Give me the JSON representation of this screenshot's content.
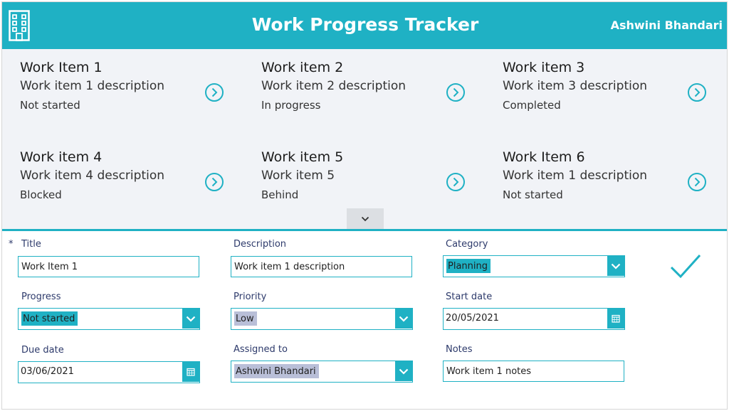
{
  "header": {
    "title": "Work Progress Tracker",
    "user_name": "Ashwini Bhandari"
  },
  "gallery": {
    "items": [
      {
        "title": "Work Item 1",
        "description": "Work item 1 description",
        "status": "Not started"
      },
      {
        "title": "Work item 2",
        "description": "Work item 2 description",
        "status": "In progress"
      },
      {
        "title": "Work item 3",
        "description": "Work item 3 description",
        "status": "Completed"
      },
      {
        "title": "Work item 4",
        "description": "Work item 4 description",
        "status": "Blocked"
      },
      {
        "title": "Work item 5",
        "description": "Work item 5",
        "status": "Behind"
      },
      {
        "title": "Work Item 6",
        "description": "Work item 1 description",
        "status": "Not started"
      }
    ]
  },
  "form": {
    "required_marker": "*",
    "title": {
      "label": "Title",
      "value": "Work Item 1"
    },
    "description": {
      "label": "Description",
      "value": "Work item 1 description"
    },
    "category": {
      "label": "Category",
      "value": "Planning"
    },
    "progress": {
      "label": "Progress",
      "value": "Not started"
    },
    "priority": {
      "label": "Priority",
      "value": "Low"
    },
    "start_date": {
      "label": "Start date",
      "value": "20/05/2021"
    },
    "due_date": {
      "label": "Due date",
      "value": "03/06/2021"
    },
    "assigned_to": {
      "label": "Assigned to",
      "value": "Ashwini Bhandari"
    },
    "notes": {
      "label": "Notes",
      "value": "Work item 1 notes"
    }
  },
  "colors": {
    "accent": "#1fb1c4",
    "gallery_bg": "#f1f3f7",
    "label_text": "#2d3a6b",
    "selected_grey": "#b9bfd8"
  },
  "icons": {
    "logo": "building-icon",
    "card_arrow": "chevron-right-circle-icon",
    "expand": "chevron-down-icon",
    "dropdown": "chevron-down-icon",
    "calendar": "calendar-icon",
    "submit": "checkmark-icon"
  }
}
